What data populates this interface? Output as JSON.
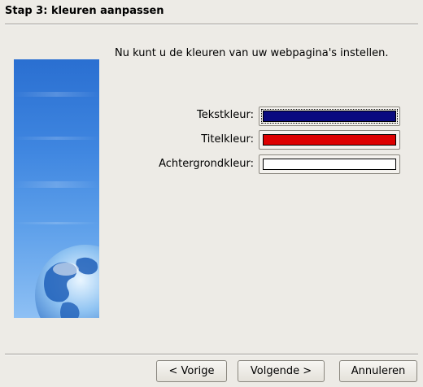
{
  "wizard": {
    "step_title": "Stap 3: kleuren aanpassen",
    "intro_text": "Nu kunt u de kleuren van uw webpagina's instellen."
  },
  "colors": {
    "text": {
      "label": "Tekstkleur:",
      "value": "#0a0a80"
    },
    "title": {
      "label": "Titelkleur:",
      "value": "#dd0000"
    },
    "background": {
      "label": "Achtergrondkleur:",
      "value": "#ffffff"
    }
  },
  "buttons": {
    "back": "< Vorige",
    "next": "Volgende >",
    "cancel": "Annuleren"
  }
}
